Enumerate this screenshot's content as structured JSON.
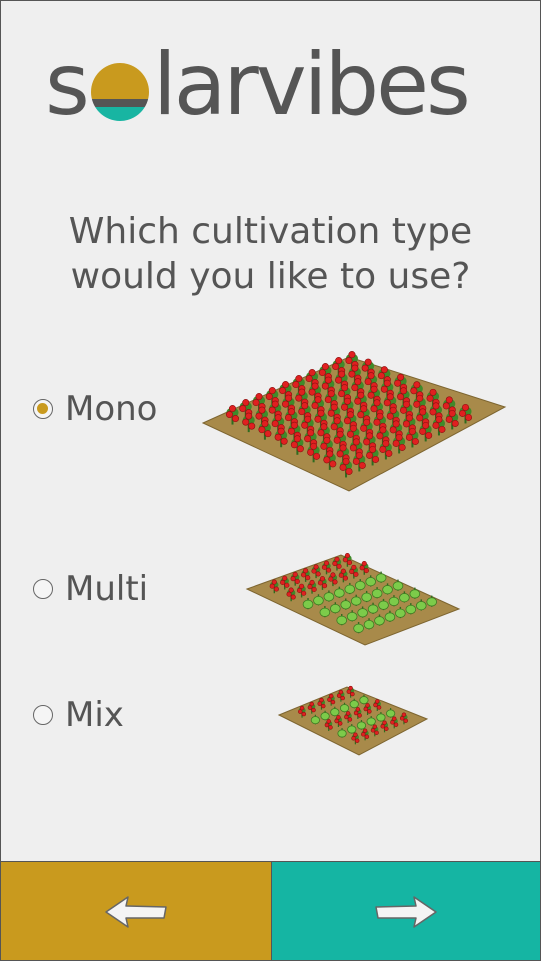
{
  "brand": {
    "name_prefix": "s",
    "name_suffix": "larvibes",
    "colors": {
      "gold": "#c99a1e",
      "teal": "#18b5a2",
      "gray": "#555555"
    }
  },
  "question": {
    "line1": "Which cultivation type",
    "line2": "would you like to use?"
  },
  "options": [
    {
      "label": "Mono",
      "selected": true
    },
    {
      "label": "Multi",
      "selected": false
    },
    {
      "label": "Mix",
      "selected": false
    }
  ],
  "nav": {
    "back_icon": "arrow-left-icon",
    "next_icon": "arrow-right-icon"
  }
}
